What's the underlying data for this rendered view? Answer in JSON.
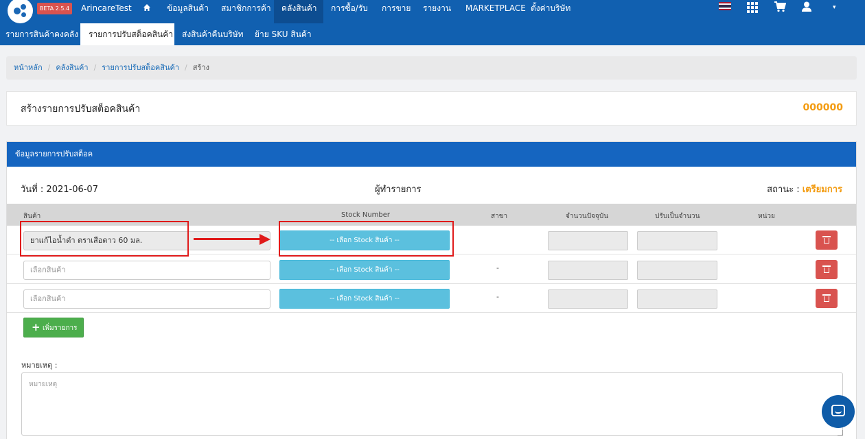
{
  "topnav": {
    "badge": "BETA 2.5.4",
    "brand": "ArincareTest",
    "items": [
      {
        "label": "ข้อมูลสินค้า"
      },
      {
        "label": "สมาชิกการค้า"
      },
      {
        "label": "คลังสินค้า"
      },
      {
        "label": "การซื้อ/รับ"
      },
      {
        "label": "การขาย"
      },
      {
        "label": "รายงาน"
      },
      {
        "label": "MARKETPLACE"
      },
      {
        "label": "ตั้งค่าบริษัท"
      }
    ]
  },
  "subnav": {
    "items": [
      {
        "label": "รายการสินค้าคงคลัง"
      },
      {
        "label": "รายการปรับสต็อคสินค้า"
      },
      {
        "label": "ส่งสินค้าคืนบริษัท"
      },
      {
        "label": "ย้าย SKU สินค้า"
      }
    ]
  },
  "breadcrumb": {
    "home": "หน้าหลัก",
    "warehouse": "คลังสินค้า",
    "adjust_list": "รายการปรับสต็อคสินค้า",
    "current": "สร้าง",
    "separator": "/"
  },
  "title_card": {
    "title": "สร้างรายการปรับสต็อคสินค้า",
    "code": "000000"
  },
  "panel": {
    "heading": "ข้อมูลรายการปรับสต็อค",
    "date_label": "วันที่ :",
    "date_value": "2021-06-07",
    "creator_label": "ผู้ทำรายการ",
    "status_label": "สถานะ :",
    "status_value": "เตรียมการ"
  },
  "table": {
    "headers": {
      "product": "สินค้า",
      "stock_number": "Stock Number",
      "branch": "สาขา",
      "current_qty": "จำนวนปัจจุบัน",
      "adjust_qty": "ปรับเป็นจำนวน",
      "unit": "หน่วย"
    },
    "rows": [
      {
        "product": "ยาแก้ไอน้ำดำ ตราเสือดาว 60 มล.",
        "stock_button": "-- เลือก Stock สินค้า --",
        "branch": ""
      },
      {
        "product_placeholder": "เลือกสินค้า",
        "stock_button": "-- เลือก Stock สินค้า --",
        "branch": "-"
      },
      {
        "product_placeholder": "เลือกสินค้า",
        "stock_button": "-- เลือก Stock สินค้า --",
        "branch": "-"
      }
    ],
    "add_button": "เพิ่มรายการ"
  },
  "remark": {
    "label": "หมายเหตุ :",
    "placeholder": "หมายเหตุ"
  },
  "colors": {
    "nav": "#1160b0",
    "panel_head": "#1565c0",
    "accent_orange": "#f39c12",
    "stock_button": "#5bc0de",
    "delete_button": "#d9534f",
    "add_button": "#4cae4c",
    "annotation": "#e01a1a"
  },
  "icons": {
    "home": "home-icon",
    "apps": "grid-icon",
    "cart": "cart-icon",
    "user": "user-icon",
    "language": "thai-flag-icon",
    "delete": "trash-icon",
    "add": "plus-icon",
    "chat": "chat-icon"
  }
}
